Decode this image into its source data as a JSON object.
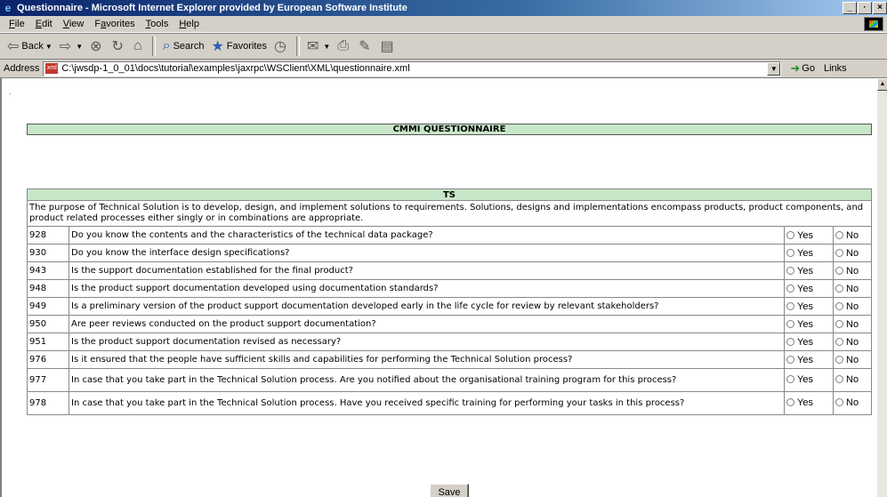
{
  "window": {
    "title": "Questionnaire - Microsoft Internet Explorer provided by European Software Institute",
    "buttons": [
      "_",
      "·",
      "×"
    ]
  },
  "menu": [
    {
      "label": "File",
      "u": "F",
      "rest": "ile"
    },
    {
      "label": "Edit",
      "u": "E",
      "rest": "dit"
    },
    {
      "label": "View",
      "u": "V",
      "rest": "iew"
    },
    {
      "label": "Favorites",
      "u": "a",
      "pre": "F",
      "rest": "vorites"
    },
    {
      "label": "Tools",
      "u": "T",
      "rest": "ools"
    },
    {
      "label": "Help",
      "u": "H",
      "rest": "elp"
    }
  ],
  "toolbar": {
    "back": "Back",
    "search": "Search",
    "favorites": "Favorites"
  },
  "address": {
    "label": "Address",
    "value": "C:\\jwsdp-1_0_01\\docs\\tutorial\\examples\\jaxrpc\\WSClient\\XML\\questionnaire.xml",
    "go": "Go",
    "links": "Links"
  },
  "page": {
    "dot": ".",
    "header": "CMMI QUESTIONNAIRE",
    "section": "TS",
    "purpose": "The purpose of Technical Solution is to develop, design, and implement solutions to requirements. Solutions, designs and implementations encompass products, product components, and product related processes either singly or in combinations are appropriate.",
    "yes_label": "Yes",
    "no_label": "No",
    "save_label": "Save",
    "questions": [
      {
        "id": "928",
        "text": "Do you know the contents and the characteristics of the technical data package?"
      },
      {
        "id": "930",
        "text": "Do you know the interface design specifications?"
      },
      {
        "id": "943",
        "text": "Is the support documentation established for the final product?"
      },
      {
        "id": "948",
        "text": "Is the product support documentation developed using documentation standards?"
      },
      {
        "id": "949",
        "text": "Is a preliminary version of the product support documentation developed early in the life cycle for review by relevant stakeholders?"
      },
      {
        "id": "950",
        "text": "Are peer reviews conducted on the product support documentation?"
      },
      {
        "id": "951",
        "text": "Is the product support documentation revised as necessary?"
      },
      {
        "id": "976",
        "text": "Is it ensured that the people have sufficient skills and capabilities for performing the Technical Solution process?"
      },
      {
        "id": "977",
        "text": "In case that you take part in the Technical Solution process. Are you notified about the organisational training program for this process?"
      },
      {
        "id": "978",
        "text": "In case that you take part in the Technical Solution process. Have you received specific training for performing your tasks in this process?"
      }
    ]
  }
}
